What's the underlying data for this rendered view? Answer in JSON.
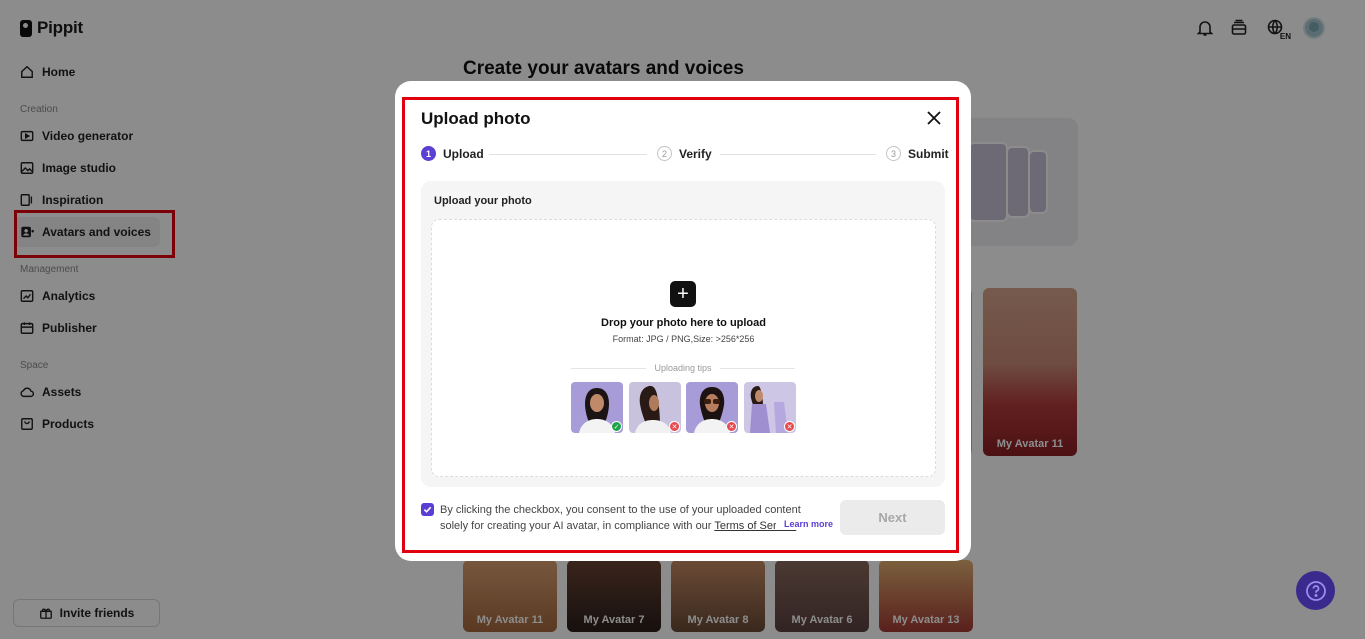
{
  "app": {
    "name": "Pippit"
  },
  "sidebar": {
    "items": [
      {
        "label": "Home",
        "icon": "home-icon"
      },
      {
        "label": "Video generator",
        "icon": "video-icon"
      },
      {
        "label": "Image studio",
        "icon": "image-icon"
      },
      {
        "label": "Inspiration",
        "icon": "inspiration-icon"
      },
      {
        "label": "Avatars and voices",
        "icon": "avatar-icon",
        "active": true
      },
      {
        "label": "Analytics",
        "icon": "analytics-icon"
      },
      {
        "label": "Publisher",
        "icon": "calendar-icon"
      },
      {
        "label": "Assets",
        "icon": "cloud-icon"
      },
      {
        "label": "Products",
        "icon": "bag-icon"
      }
    ],
    "sections": {
      "creation": "Creation",
      "management": "Management",
      "space": "Space"
    },
    "invite_label": "Invite friends"
  },
  "header": {
    "language": "EN",
    "icons": [
      "bell-icon",
      "layers-icon",
      "globe-icon",
      "user-avatar"
    ]
  },
  "main": {
    "title": "Create your avatars and voices",
    "avatars": [
      {
        "label": "My Avatar 11"
      },
      {
        "label": "My Avatar 11"
      },
      {
        "label": "My Avatar 7"
      },
      {
        "label": "My Avatar 8"
      },
      {
        "label": "My Avatar 6"
      },
      {
        "label": "My Avatar 13"
      }
    ]
  },
  "modal": {
    "title": "Upload photo",
    "steps": [
      {
        "num": "1",
        "label": "Upload",
        "active": true
      },
      {
        "num": "2",
        "label": "Verify",
        "active": false
      },
      {
        "num": "3",
        "label": "Submit",
        "active": false
      }
    ],
    "panel_title": "Upload your photo",
    "drop_text": "Drop your photo here to upload",
    "format_text": "Format: JPG / PNG,Size: >256*256",
    "tips_label": "Uploading tips",
    "tips": [
      {
        "status": "ok",
        "status_glyph": "✓"
      },
      {
        "status": "bad",
        "status_glyph": "✕"
      },
      {
        "status": "bad",
        "status_glyph": "✕"
      },
      {
        "status": "bad",
        "status_glyph": "✕"
      }
    ],
    "consent": {
      "checked": true,
      "line1": "By clicking the checkbox, you consent to the use of your uploaded content",
      "line2": "solely for creating your AI avatar, in compliance with our ",
      "terms": "Terms of Service",
      "learn_more": "Learn more"
    },
    "next_label": "Next"
  },
  "colors": {
    "accent": "#5b3fd4",
    "highlight": "#e0000f",
    "help_button": "#3a2a8e"
  }
}
